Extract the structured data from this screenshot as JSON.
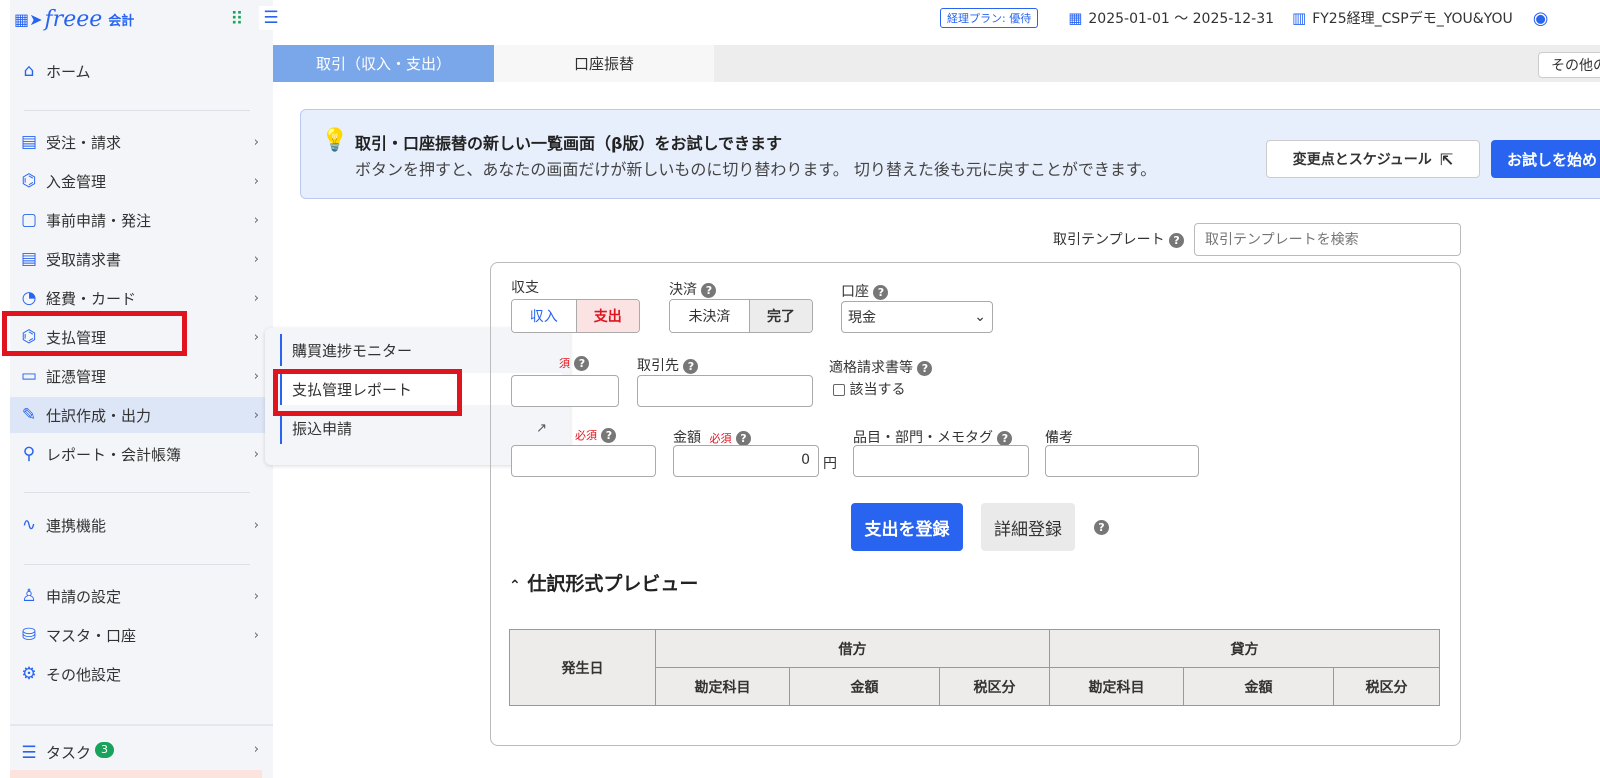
{
  "app": {
    "logo": "freee",
    "logo_sub": "会計"
  },
  "header": {
    "plan_badge": "経理プラン: 優待",
    "period": "2025-01-01 〜 2025-12-31",
    "company": "FY25経理_CSPデモ_YOU&YOU"
  },
  "sidebar": {
    "items": [
      {
        "label": "ホーム"
      },
      {
        "label": "受注・請求"
      },
      {
        "label": "入金管理"
      },
      {
        "label": "事前申請・発注"
      },
      {
        "label": "受取請求書"
      },
      {
        "label": "経費・カード"
      },
      {
        "label": "支払管理"
      },
      {
        "label": "証憑管理"
      },
      {
        "label": "仕訳作成・出力"
      },
      {
        "label": "レポート・会計帳簿"
      },
      {
        "label": "連携機能"
      },
      {
        "label": "申請の設定"
      },
      {
        "label": "マスタ・口座"
      },
      {
        "label": "その他設定"
      },
      {
        "label": "タスク",
        "badge": "3"
      }
    ]
  },
  "flyout": {
    "items": [
      {
        "label": "購買進捗モニター"
      },
      {
        "label": "支払管理レポート"
      },
      {
        "label": "振込申請"
      }
    ]
  },
  "tabs": [
    {
      "label": "取引（収入・支出）"
    },
    {
      "label": "口座振替"
    }
  ],
  "other_button": "その他の",
  "banner": {
    "title": "取引・口座振替の新しい一覧画面（β版）をお試しできます",
    "text": "ボタンを押すと、あなたの画面だけが新しいものに切り替わります。 切り替えた後も元に戻すことができます。",
    "schedule_button": "変更点とスケジュール",
    "try_button": "お試しを始め"
  },
  "template": {
    "label": "取引テンプレート",
    "placeholder": "取引テンプレートを検索"
  },
  "form": {
    "income_expense_label": "収支",
    "income": "収入",
    "expense": "支出",
    "settlement_label": "決済",
    "unsettled": "未決済",
    "settled": "完了",
    "account_label": "口座",
    "account_value": "現金",
    "required_partial": "須",
    "partner_label": "取引先",
    "invoice_label": "適格請求書等",
    "invoice_check": "該当する",
    "required": "必須",
    "amount_label": "金額",
    "amount_value": "0",
    "yen": "円",
    "item_label": "品目・部門・メモタグ",
    "memo_label": "備考",
    "submit": "支出を登録",
    "detail": "詳細登録"
  },
  "preview": {
    "title": "仕訳形式プレビュー",
    "date_col": "発生日",
    "debit": "借方",
    "credit": "貸方",
    "account": "勘定科目",
    "amount": "金額",
    "tax": "税区分"
  }
}
